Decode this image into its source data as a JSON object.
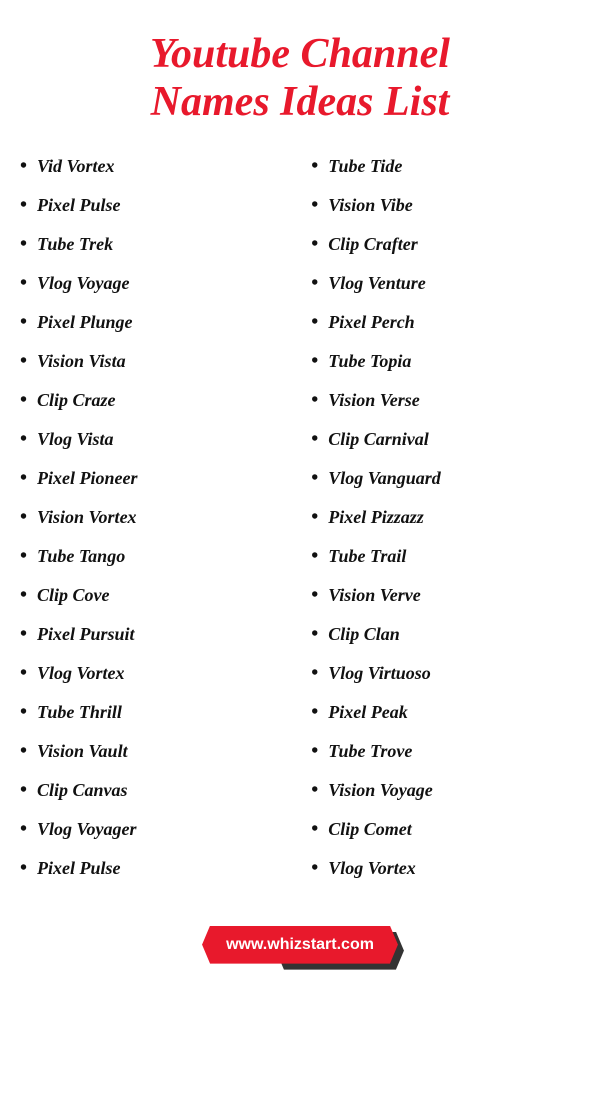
{
  "title": {
    "line1": "Youtube Channel",
    "line2": "Names Ideas List"
  },
  "left_column": [
    "Vid Vortex",
    "Pixel Pulse",
    "Tube Trek",
    "Vlog Voyage",
    "Pixel Plunge",
    "Vision Vista",
    "Clip Craze",
    "Vlog Vista",
    "Pixel Pioneer",
    "Vision Vortex",
    "Tube Tango",
    "Clip Cove",
    "Pixel Pursuit",
    "Vlog Vortex",
    "Tube Thrill",
    "Vision Vault",
    "Clip Canvas",
    "Vlog Voyager",
    "Pixel Pulse"
  ],
  "right_column": [
    "Tube Tide",
    "Vision Vibe",
    "Clip Crafter",
    "Vlog Venture",
    "Pixel Perch",
    "Tube Topia",
    "Vision Verse",
    "Clip Carnival",
    "Vlog Vanguard",
    "Pixel Pizzazz",
    "Tube Trail",
    "Vision Verve",
    "Clip Clan",
    "Vlog Virtuoso",
    "Pixel Peak",
    "Tube Trove",
    "Vision Voyage",
    "Clip Comet",
    "Vlog Vortex"
  ],
  "footer": {
    "url": "www.whizstart.com"
  }
}
